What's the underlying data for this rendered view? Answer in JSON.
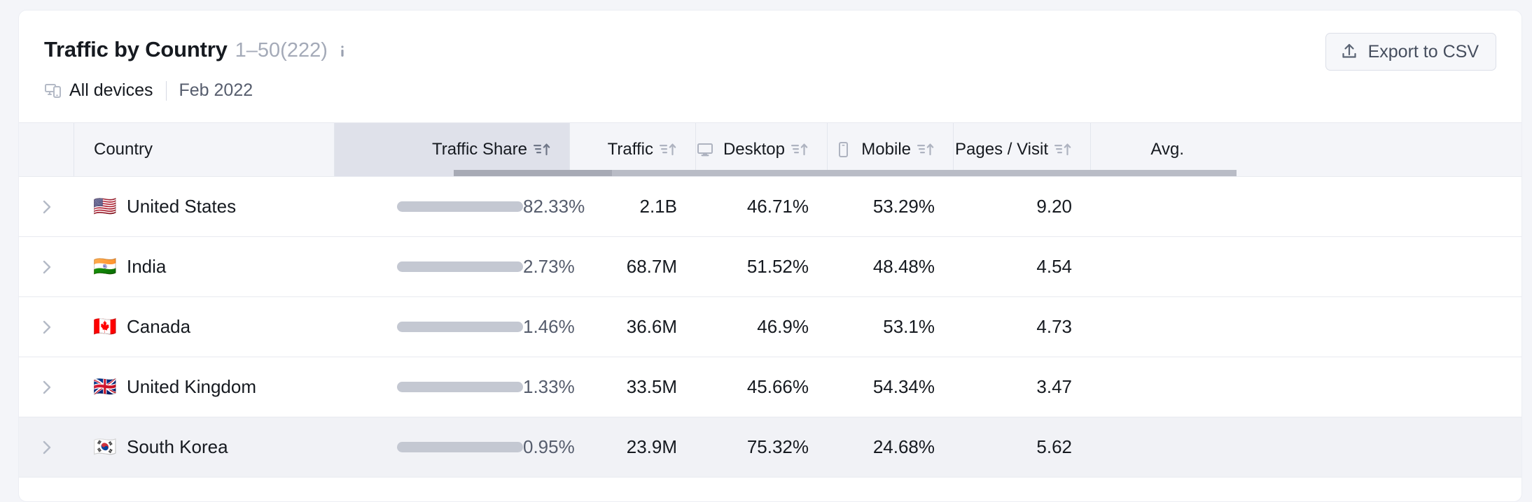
{
  "panel": {
    "title": "Traffic by Country",
    "range": "1–50(222)",
    "info_icon": "info-icon",
    "devices_icon": "all-devices-icon",
    "devices_label": "All devices",
    "period": "Feb 2022",
    "export_label": "Export to CSV",
    "export_icon": "upload-icon"
  },
  "colors": {
    "bar_fill": "#54aef4",
    "bar_track": "#c4c8d2",
    "active_header": "#dfe1ea",
    "row_hover": "#f1f2f6"
  },
  "table": {
    "columns": [
      {
        "key": "expand",
        "label": "",
        "align": "center",
        "icon": "",
        "sortable": false,
        "active": false
      },
      {
        "key": "country",
        "label": "Country",
        "align": "left",
        "icon": "",
        "sortable": false,
        "active": false
      },
      {
        "key": "share",
        "label": "Traffic Share",
        "align": "right",
        "icon": "",
        "sortable": true,
        "active": true
      },
      {
        "key": "traffic",
        "label": "Traffic",
        "align": "right",
        "icon": "",
        "sortable": true,
        "active": false
      },
      {
        "key": "desktop",
        "label": "Desktop",
        "align": "right",
        "icon": "desktop-icon",
        "sortable": true,
        "active": false
      },
      {
        "key": "mobile",
        "label": "Mobile",
        "align": "right",
        "icon": "mobile-icon",
        "sortable": true,
        "active": false
      },
      {
        "key": "pages",
        "label": "Pages / Visit",
        "align": "right",
        "icon": "",
        "sortable": true,
        "active": false
      },
      {
        "key": "avg",
        "label": "Avg.",
        "align": "right",
        "icon": "",
        "sortable": false,
        "active": false
      }
    ],
    "sort": {
      "column": "Traffic Share",
      "direction": "desc"
    },
    "rows": [
      {
        "flag": "🇺🇸",
        "country": "United States",
        "share": "82.33%",
        "share_pct": 82.33,
        "traffic": "2.1B",
        "desktop": "46.71%",
        "mobile": "53.29%",
        "pages": "9.20",
        "hover": false
      },
      {
        "flag": "🇮🇳",
        "country": "India",
        "share": "2.73%",
        "share_pct": 2.73,
        "traffic": "68.7M",
        "desktop": "51.52%",
        "mobile": "48.48%",
        "pages": "4.54",
        "hover": false
      },
      {
        "flag": "🇨🇦",
        "country": "Canada",
        "share": "1.46%",
        "share_pct": 1.46,
        "traffic": "36.6M",
        "desktop": "46.9%",
        "mobile": "53.1%",
        "pages": "4.73",
        "hover": false
      },
      {
        "flag": "🇬🇧",
        "country": "United Kingdom",
        "share": "1.33%",
        "share_pct": 1.33,
        "traffic": "33.5M",
        "desktop": "45.66%",
        "mobile": "54.34%",
        "pages": "3.47",
        "hover": false
      },
      {
        "flag": "🇰🇷",
        "country": "South Korea",
        "share": "0.95%",
        "share_pct": 0.95,
        "traffic": "23.9M",
        "desktop": "75.32%",
        "mobile": "24.68%",
        "pages": "5.62",
        "hover": true
      }
    ]
  },
  "chart_data": {
    "type": "bar",
    "title": "Traffic by Country",
    "xlabel": "Traffic Share",
    "ylabel": "Country",
    "categories": [
      "United States",
      "India",
      "Canada",
      "United Kingdom",
      "South Korea"
    ],
    "values": [
      82.33,
      2.73,
      1.46,
      1.33,
      0.95
    ],
    "unit": "%",
    "ylim": [
      0,
      100
    ],
    "grid": false,
    "legend": "none"
  }
}
